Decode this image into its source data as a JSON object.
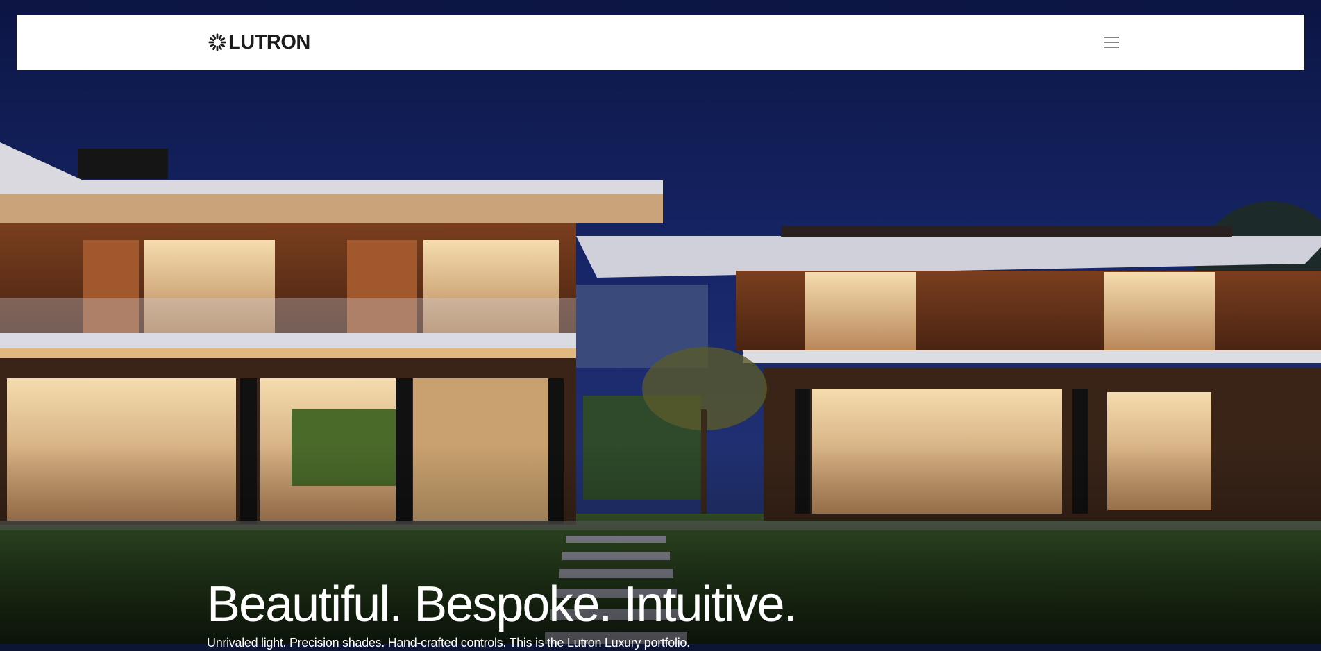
{
  "header": {
    "logo_text": "LUTRON",
    "logo_icon": "lutron-sunburst-icon",
    "menu_icon": "hamburger-menu-icon"
  },
  "hero": {
    "image_subject": "modern-house-at-dusk",
    "headline": "Beautiful. Bespoke. Intuitive.",
    "subheadline": "Unrivaled light. Precision shades. Hand-crafted controls. This is the Lutron Luxury portfolio."
  },
  "colors": {
    "header_bg": "#ffffff",
    "logo": "#1b1b1b",
    "sky": "#13215e",
    "text": "#ffffff"
  }
}
